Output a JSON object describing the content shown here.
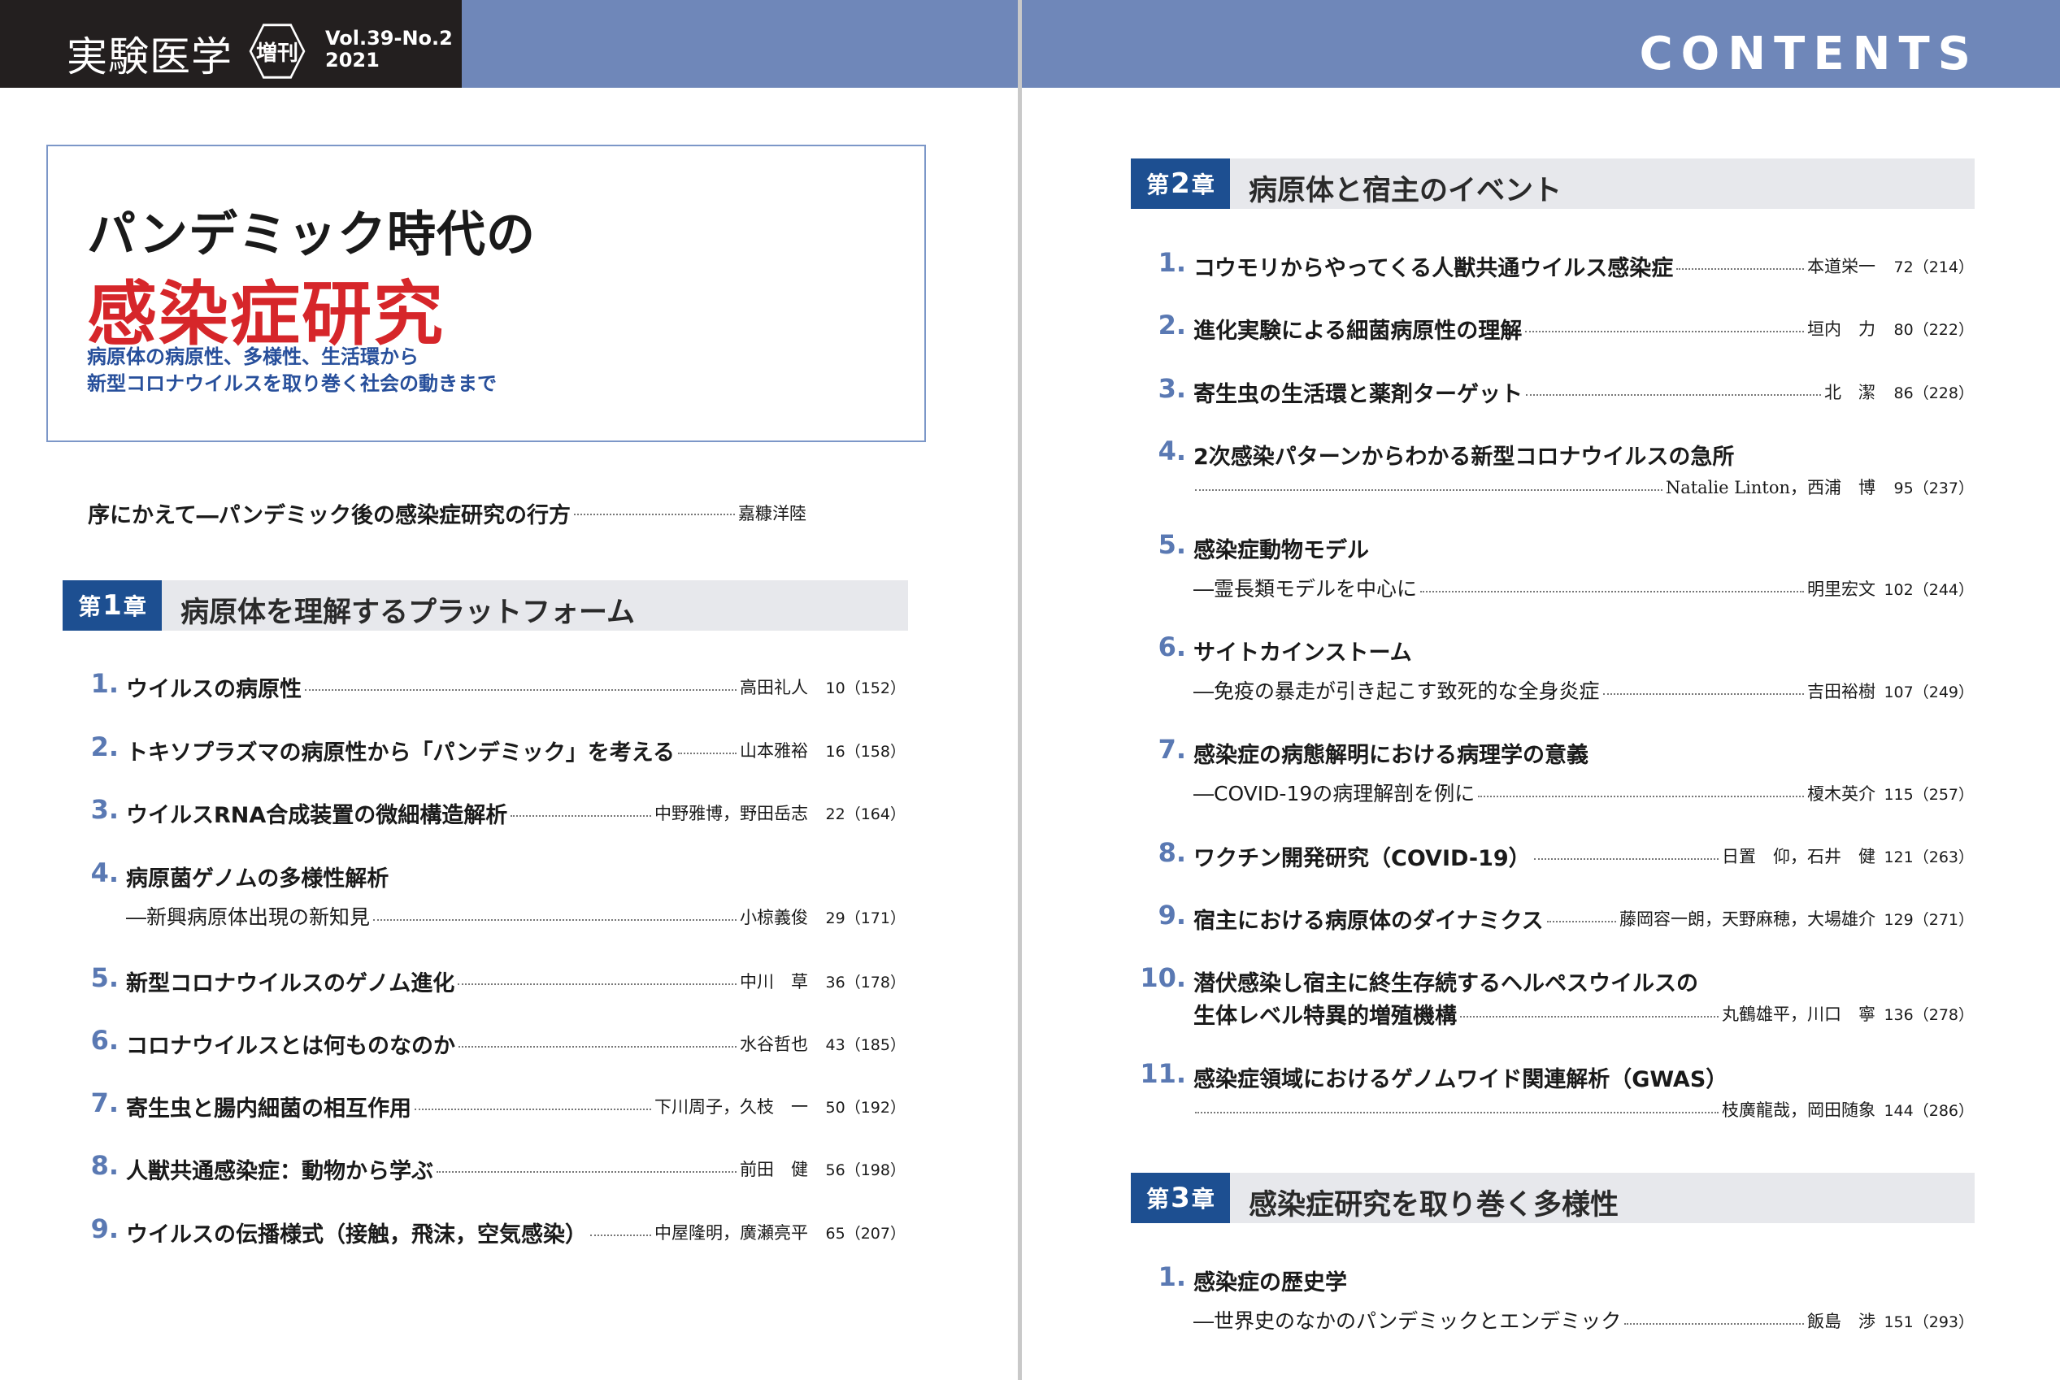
{
  "header": {
    "brand": "実験医学",
    "badge": "増刊",
    "volume": "Vol.39-No.2",
    "year": "2021",
    "contents_label": "CONTENTS",
    "colors": {
      "dark": "#231f1f",
      "blue": "#6f87b9"
    }
  },
  "book": {
    "title_line1": "パンデミック時代の",
    "title_line2": "感染症研究",
    "subtitle_line1": "病原体の病原性、多様性、生活環から",
    "subtitle_line2": "新型コロナウイルスを取り巻く社会の動きまで",
    "title_color": "#d6262a"
  },
  "preface": {
    "title": "序にかえて―パンデミック後の感染症研究の行方",
    "author": "嘉糠洋陸"
  },
  "chapter1": {
    "label_prefix": "第",
    "label_num": "1",
    "label_suffix": "章",
    "title": "病原体を理解するプラットフォーム",
    "entries": [
      {
        "num": "1.",
        "title": "ウイルスの病原性",
        "sub": "",
        "author": "高田礼人",
        "page": "10（152）"
      },
      {
        "num": "2.",
        "title": "トキソプラズマの病原性から「パンデミック」を考える",
        "sub": "",
        "author": "山本雅裕",
        "page": "16（158）"
      },
      {
        "num": "3.",
        "title": "ウイルスRNA合成装置の微細構造解析",
        "sub": "",
        "author": "中野雅博，野田岳志",
        "page": "22（164）"
      },
      {
        "num": "4.",
        "title": "病原菌ゲノムの多様性解析",
        "sub": "―新興病原体出現の新知見",
        "author": "小椋義俊",
        "page": "29（171）"
      },
      {
        "num": "5.",
        "title": "新型コロナウイルスのゲノム進化",
        "sub": "",
        "author": "中川　草",
        "page": "36（178）"
      },
      {
        "num": "6.",
        "title": "コロナウイルスとは何ものなのか",
        "sub": "",
        "author": "水谷哲也",
        "page": "43（185）"
      },
      {
        "num": "7.",
        "title": "寄生虫と腸内細菌の相互作用",
        "sub": "",
        "author": "下川周子，久枝　一",
        "page": "50（192）"
      },
      {
        "num": "8.",
        "title": "人獣共通感染症：動物から学ぶ",
        "sub": "",
        "author": "前田　健",
        "page": "56（198）"
      },
      {
        "num": "9.",
        "title": "ウイルスの伝播様式（接触，飛沫，空気感染）",
        "sub": "",
        "author": "中屋隆明，廣瀬亮平",
        "page": "65（207）"
      }
    ]
  },
  "chapter2": {
    "label_prefix": "第",
    "label_num": "2",
    "label_suffix": "章",
    "title": "病原体と宿主のイベント",
    "entries": [
      {
        "num": "1.",
        "title": "コウモリからやってくる人獣共通ウイルス感染症",
        "sub": "",
        "author": "本道栄一",
        "page": "72（214）"
      },
      {
        "num": "2.",
        "title": "進化実験による細菌病原性の理解",
        "sub": "",
        "author": "垣内　力",
        "page": "80（222）"
      },
      {
        "num": "3.",
        "title": "寄生虫の生活環と薬剤ターゲット",
        "sub": "",
        "author": "北　潔",
        "page": "86（228）"
      },
      {
        "num": "4.",
        "title": "2次感染パターンからわかる新型コロナウイルスの急所",
        "sub": "",
        "author": "Natalie Linton，西浦　博",
        "page": "95（237）"
      },
      {
        "num": "5.",
        "title": "感染症動物モデル",
        "sub": "―霊長類モデルを中心に",
        "author": "明里宏文",
        "page": "102（244）"
      },
      {
        "num": "6.",
        "title": "サイトカインストーム",
        "sub": "―免疫の暴走が引き起こす致死的な全身炎症",
        "author": "吉田裕樹",
        "page": "107（249）"
      },
      {
        "num": "7.",
        "title": "感染症の病態解明における病理学の意義",
        "sub": "―COVID-19の病理解剖を例に",
        "author": "榎木英介",
        "page": "115（257）"
      },
      {
        "num": "8.",
        "title": "ワクチン開発研究（COVID-19）",
        "sub": "",
        "author": "日置　仰，石井　健",
        "page": "121（263）"
      },
      {
        "num": "9.",
        "title": "宿主における病原体のダイナミクス",
        "sub": "",
        "author": "藤岡容一朗，天野麻穂，大場雄介",
        "page": "129（271）"
      },
      {
        "num": "10.",
        "title": "潜伏感染し宿主に終生存続するヘルペスウイルスの",
        "title2": "生体レベル特異的増殖機構",
        "sub": "",
        "author": "丸鶴雄平，川口　寧",
        "page": "136（278）"
      },
      {
        "num": "11.",
        "title": "感染症領域におけるゲノムワイド関連解析（GWAS）",
        "sub": "",
        "author": "枝廣龍哉，岡田随象",
        "page": "144（286）"
      }
    ]
  },
  "chapter3": {
    "label_prefix": "第",
    "label_num": "3",
    "label_suffix": "章",
    "title": "感染症研究を取り巻く多様性",
    "entries": [
      {
        "num": "1.",
        "title": "感染症の歴史学",
        "sub": "―世界史のなかのパンデミックとエンデミック",
        "author": "飯島　渉",
        "page": "151（293）"
      }
    ]
  }
}
